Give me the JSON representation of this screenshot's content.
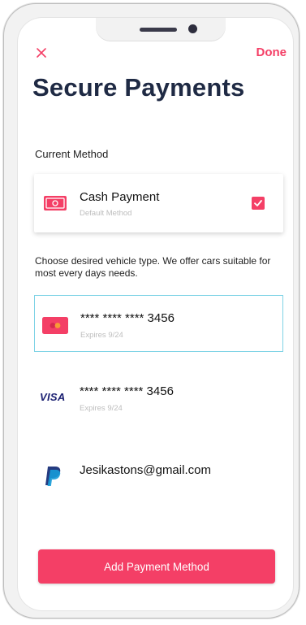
{
  "header": {
    "close_icon": "close-icon",
    "done_label": "Done",
    "title": "Secure Payments"
  },
  "current_method": {
    "section_label": "Current Method",
    "name": "Cash Payment",
    "subtitle": "Default Method",
    "icon": "cash-icon",
    "checked": true
  },
  "description": "Choose desired vehicle type. We offer cars suitable for most every days needs.",
  "methods": [
    {
      "icon": "mastercard-icon",
      "title": "**** **** **** 3456",
      "subtitle": "Expires 9/24",
      "selected": true
    },
    {
      "icon": "visa-icon",
      "icon_text": "VISA",
      "title": "**** **** **** 3456",
      "subtitle": "Expires 9/24",
      "selected": false
    },
    {
      "icon": "paypal-icon",
      "title": "Jesikastons@gmail.com",
      "selected": false
    }
  ],
  "add_button_label": "Add Payment Method",
  "colors": {
    "accent": "#f43f66",
    "title": "#1f2a44",
    "selected_border": "#7fd3e6",
    "muted": "#bdbdbd"
  }
}
